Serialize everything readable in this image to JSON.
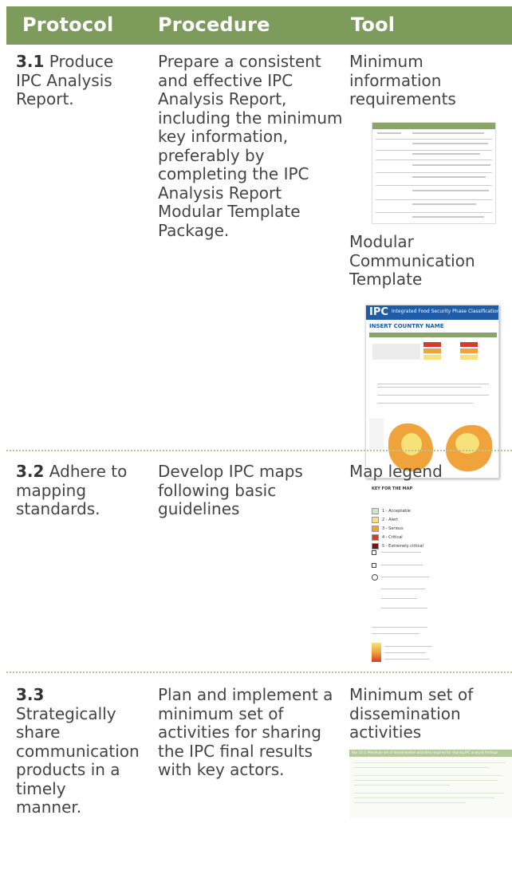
{
  "header": {
    "protocol": "Protocol",
    "procedure": "Procedure",
    "tool": "Tool"
  },
  "rows": [
    {
      "protocol_number": "3.1",
      "protocol_text": "Produce IPC Analysis Report.",
      "procedure": "Prepare a consistent and effective IPC Analysis Report, including the minimum key information, preferably by completing the IPC Analysis Report Modular Template Package.",
      "tools": [
        "Minimum information requirements",
        "Modular Communication Template"
      ]
    },
    {
      "protocol_number": "3.2",
      "protocol_text": "Adhere to mapping standards.",
      "procedure": "Develop IPC maps following basic guidelines",
      "tools": [
        "Map legend"
      ]
    },
    {
      "protocol_number": "3.3",
      "protocol_text": "Strategically share communication products in a timely manner.",
      "procedure": "Plan and implement a minimum set of activities for sharing the IPC final results with key actors.",
      "tools": [
        "Minimum set of dissemination activities"
      ]
    }
  ],
  "thumbnails": {
    "template_logo": "IPC",
    "template_banner": "Integrated Food Security Phase Classification",
    "template_country": "INSERT COUNTRY NAME",
    "legend_title": "KEY FOR THE MAP",
    "legend_phases": [
      "1 - Acceptable",
      "2 - Alert",
      "3 - Serious",
      "4 - Critical",
      "5 - Extremely critical"
    ],
    "phase_colors": [
      "#cde6c4",
      "#f7e27a",
      "#f0a23b",
      "#d63b2a",
      "#7a1414"
    ],
    "box_title": "Box 13.1: Minimum set of dissemination activities required for sharing IPC analysis findings"
  }
}
